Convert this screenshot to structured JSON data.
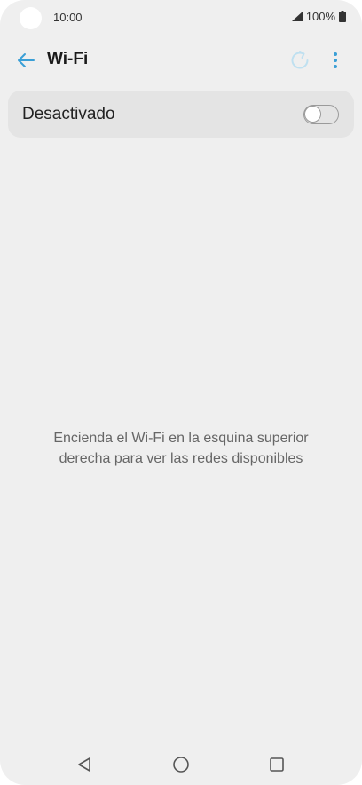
{
  "status_bar": {
    "time": "10:00",
    "battery": "100%",
    "icons": [
      "signal-icon",
      "battery-icon"
    ]
  },
  "header": {
    "title": "Wi-Fi",
    "icons": [
      "back-arrow-icon",
      "refresh-icon",
      "more-vert-icon"
    ]
  },
  "wifi_toggle": {
    "label": "Desactivado",
    "state": "off"
  },
  "empty_state": {
    "line1": "Encienda el Wi-Fi en la esquina superior",
    "line2": "derecha para ver las redes disponibles"
  },
  "nav_bar": {
    "icons": [
      "nav-back-icon",
      "nav-home-icon",
      "nav-recent-apps-icon"
    ]
  },
  "colors": {
    "background": "#efefef",
    "card": "#e4e4e4",
    "accent": "#3a9fd6",
    "refresh_muted": "#bfe0f0"
  }
}
